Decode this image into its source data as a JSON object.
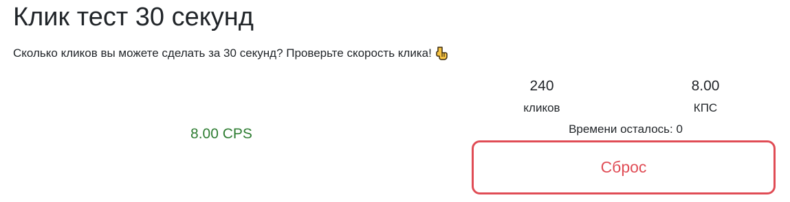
{
  "page": {
    "title": "Клик тест 30 секунд",
    "subtitle": "Сколько кликов вы можете сделать за 30 секунд? Проверьте скорость клика!",
    "subtitle_icon": "hand-pointing-down-icon"
  },
  "test": {
    "cps_display": "8.00 CPS",
    "clicks_value": "240",
    "clicks_label": "кликов",
    "cps_value": "8.00",
    "cps_label": "КПС",
    "time_left": "Времени осталось: 0",
    "reset_label": "Сброс"
  },
  "colors": {
    "accent_green": "#2e7d32",
    "reset_red": "#e04c55",
    "text": "#212529"
  }
}
